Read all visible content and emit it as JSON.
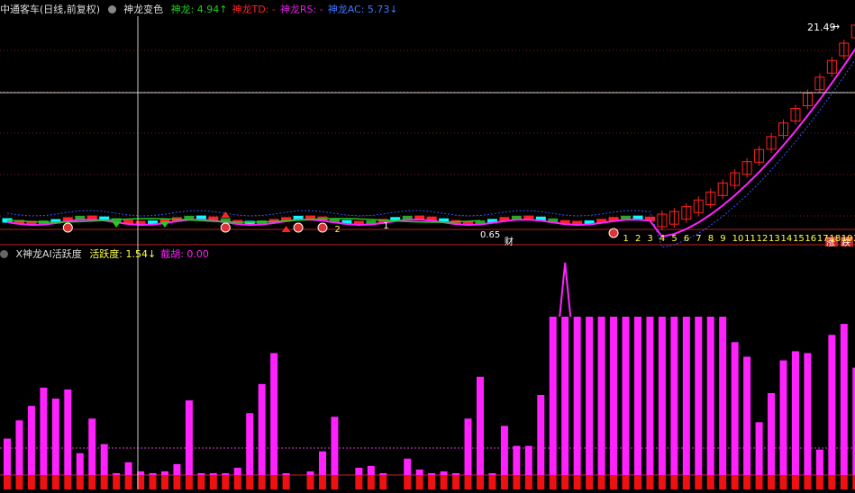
{
  "top_panel": {
    "title": "中通客车(日线,前复权)",
    "indicator_name": "神龙变色",
    "legend": [
      {
        "label": "神龙: 4.94",
        "arrow": "↑",
        "color": "#22cc22"
      },
      {
        "label": "神龙TD: -",
        "arrow": "",
        "color": "#ff2222"
      },
      {
        "label": "神龙RS: -",
        "arrow": "",
        "color": "#dd22dd"
      },
      {
        "label": "神龙AC: 5.73",
        "arrow": "↓",
        "color": "#4477ff"
      }
    ],
    "price_label": "21.49",
    "day_counters": [
      "1",
      "2",
      "3",
      "4",
      "5",
      "6",
      "7",
      "8",
      "9",
      "10",
      "11",
      "12",
      "13",
      "14",
      "15",
      "16",
      "17",
      "18",
      "19",
      "20"
    ],
    "small_labels": [
      {
        "text": "2",
        "color": "#ffff44"
      },
      {
        "text": "1",
        "color": "#ffffff"
      },
      {
        "text": "0.65",
        "color": "#ffffff"
      },
      {
        "text": "财",
        "color": "#ffffff"
      }
    ],
    "corner_badges": [
      {
        "text": "涨",
        "bg": "#cc2222"
      },
      {
        "text": "跌",
        "bg": "#cc2222"
      }
    ]
  },
  "bottom_panel": {
    "indicator_name": "X神龙AI活跃度",
    "legend": [
      {
        "label": "活跃度: 1.54",
        "arrow": "↓",
        "color": "#ffff44"
      },
      {
        "label": "截胡: 0.00",
        "arrow": "",
        "color": "#ff22ff"
      }
    ],
    "activity_values": [
      20,
      30,
      38,
      48,
      42,
      47,
      12,
      31,
      17,
      1,
      7,
      2,
      1,
      2,
      6,
      41,
      1,
      1,
      1,
      4,
      34,
      50,
      67,
      1,
      0,
      2,
      13,
      32,
      0,
      4,
      5,
      1,
      0,
      9,
      3,
      1,
      2,
      1,
      31,
      54,
      1,
      27,
      16,
      16,
      44,
      87,
      87,
      87,
      87,
      87,
      87,
      87,
      87,
      87,
      87,
      87,
      87,
      87,
      87,
      87,
      73,
      65,
      29,
      45,
      63,
      68,
      67,
      14,
      77,
      83,
      59
    ]
  },
  "colors": {
    "bg": "#000000",
    "up": "#ff2222",
    "down": "#00ffff",
    "magenta": "#ff22ff",
    "ma_blue": "#3355ff",
    "grid": "#7a1c1c",
    "cursor": "#cccccc"
  }
}
